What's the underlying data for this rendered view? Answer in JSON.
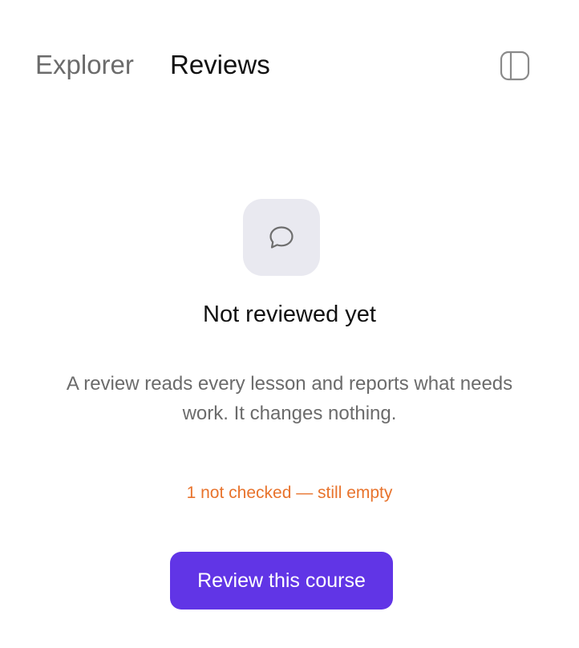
{
  "header": {
    "tabs": [
      {
        "label": "Explorer",
        "active": false
      },
      {
        "label": "Reviews",
        "active": true
      }
    ],
    "panel_toggle_icon": "sidebar-panel-icon"
  },
  "empty_state": {
    "icon": "chat-bubble-icon",
    "title": "Not reviewed yet",
    "description": "A review reads every lesson and reports what needs work. It changes nothing.",
    "warning": "1 not checked — still empty",
    "action_label": "Review this course"
  },
  "colors": {
    "accent": "#6135e6",
    "warning": "#e8732c",
    "muted_text": "#6b6b6b",
    "icon_tile_bg": "#e9e9f0"
  }
}
